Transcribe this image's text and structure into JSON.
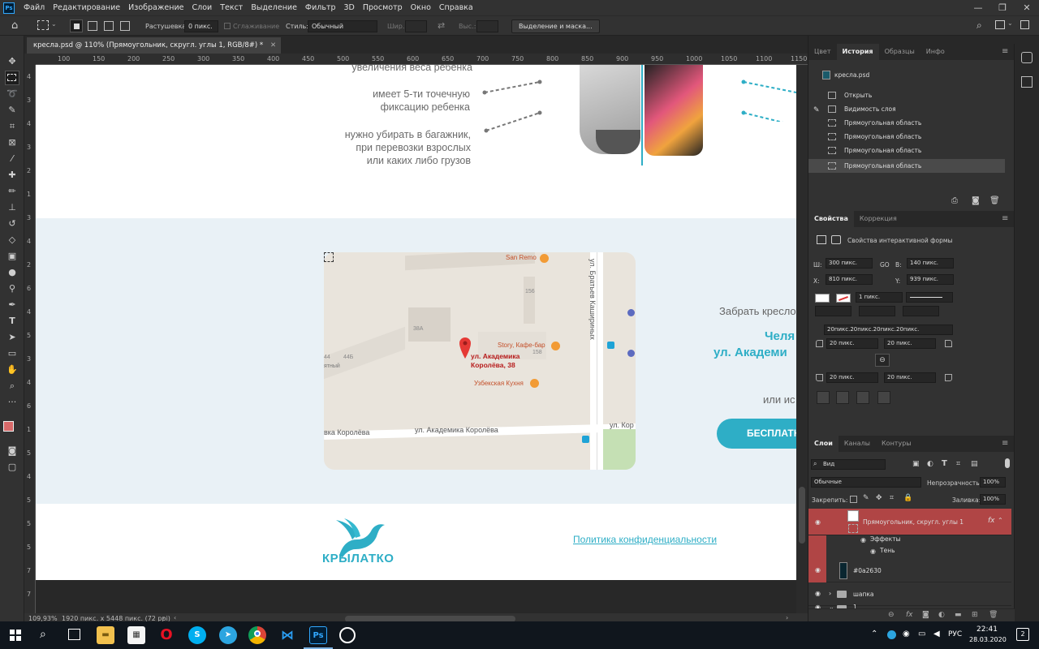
{
  "menubar": {
    "app_icon": "Ps",
    "items": [
      "Файл",
      "Редактирование",
      "Изображение",
      "Слои",
      "Текст",
      "Выделение",
      "Фильтр",
      "3D",
      "Просмотр",
      "Окно",
      "Справка"
    ]
  },
  "options": {
    "feather_label": "Растушевка:",
    "feather_value": "0 пикс.",
    "antialias_label": "Сглаживание",
    "style_label": "Стиль:",
    "style_value": "Обычный",
    "width_label": "Шир.:",
    "height_label": "Выс.:",
    "select_mask_button": "Выделение и маска..."
  },
  "document": {
    "tab_title": "кресла.psd @ 110% (Прямоугольник, скругл. углы 1, RGB/8#) *",
    "ruler_h": [
      "100",
      "150",
      "200",
      "250",
      "300",
      "350",
      "400",
      "450",
      "500",
      "550",
      "600",
      "650",
      "700",
      "750",
      "800",
      "850",
      "900",
      "950",
      "1000",
      "1050",
      "1100",
      "1150"
    ],
    "ruler_v": [
      "4",
      "3",
      "4",
      "3",
      "2",
      "1",
      "3",
      "4",
      "2",
      "6",
      "4",
      "5",
      "3",
      "4",
      "6",
      "1",
      "5",
      "4",
      "5",
      "5",
      "5",
      "7",
      "7"
    ]
  },
  "canvas": {
    "feature_texts": [
      "увеличения веса ребенка",
      "имеет 5-ти точечную\nфиксацию ребенка",
      "нужно убирать в багажник,\nпри перевозки взрослых\nили каких либо грузов"
    ],
    "pickup_text": "Забрать кресло",
    "city_text": "Челя",
    "address_text": "ул. Академи",
    "or_text": "или ис",
    "cta_button": "БЕСПЛАТН",
    "logo_text": "КРЫЛАТКО",
    "privacy_link": "Политика конфиденциальности",
    "map": {
      "marker_label": "ул. Академика\nКоролёва, 38",
      "poi": [
        "San Remo",
        "Story, Кафе-бар",
        "Узбекская Кухня"
      ],
      "building_numbers": [
        "156",
        "158",
        "38А",
        "44Б",
        "44"
      ],
      "streets": [
        "ул. Братьев Кашириных",
        "ул. Академика Королёва",
        "вка Королёва",
        "ул. Кор",
        "ятный"
      ]
    }
  },
  "status": {
    "zoom": "109,93%",
    "doc_size": "1920 пикс. x 5448 пикс. (72 ppi)"
  },
  "history_panel": {
    "tabs": [
      "Цвет",
      "История",
      "Образцы",
      "Инфо"
    ],
    "active_tab": "История",
    "snapshot": "кресла.psd",
    "items": [
      "Открыть",
      "Видимость слоя",
      "Прямоугольная область",
      "Прямоугольная область",
      "Прямоугольная область",
      "Прямоугольная область"
    ]
  },
  "properties_panel": {
    "tabs": [
      "Свойства",
      "Коррекция"
    ],
    "active_tab": "Свойства",
    "title": "Свойства интерактивной формы",
    "w_label": "Ш:",
    "w_value": "300 пикс.",
    "go_label": "GO",
    "h_label": "В:",
    "h_value": "140 пикс.",
    "x_label": "X:",
    "x_value": "810 пикс.",
    "y_label": "Y:",
    "y_value": "939 пикс.",
    "stroke_value": "1 пикс.",
    "radius_all": "20пикс.20пикс.20пикс.20пикс.",
    "radius_tl": "20 пикс.",
    "radius_tr": "20 пикс.",
    "radius_bl": "20 пикс.",
    "radius_br": "20 пикс."
  },
  "layers_panel": {
    "tabs": [
      "Слои",
      "Каналы",
      "Контуры"
    ],
    "active_tab": "Слои",
    "filter_kind": "Вид",
    "blend_mode": "Обычные",
    "opacity_label": "Непрозрачность:",
    "opacity_value": "100%",
    "lock_label": "Закрепить:",
    "fill_label": "Заливка:",
    "fill_value": "100%",
    "layers": [
      {
        "name": "Прямоугольник, скругл. углы 1",
        "fx": "fx"
      },
      {
        "name": "Эффекты"
      },
      {
        "name": "Тень"
      },
      {
        "name": "#0a2630"
      },
      {
        "name": "шапка"
      },
      {
        "name": "1"
      }
    ]
  },
  "taskbar": {
    "lang": "РУС",
    "time": "22:41",
    "date": "28.03.2020",
    "notifications": "2"
  },
  "colors": {
    "accent": "#2eaec6",
    "selected_layer": "#b04545",
    "map_pin": "#e53935",
    "section_bg": "#e9f1f6"
  }
}
